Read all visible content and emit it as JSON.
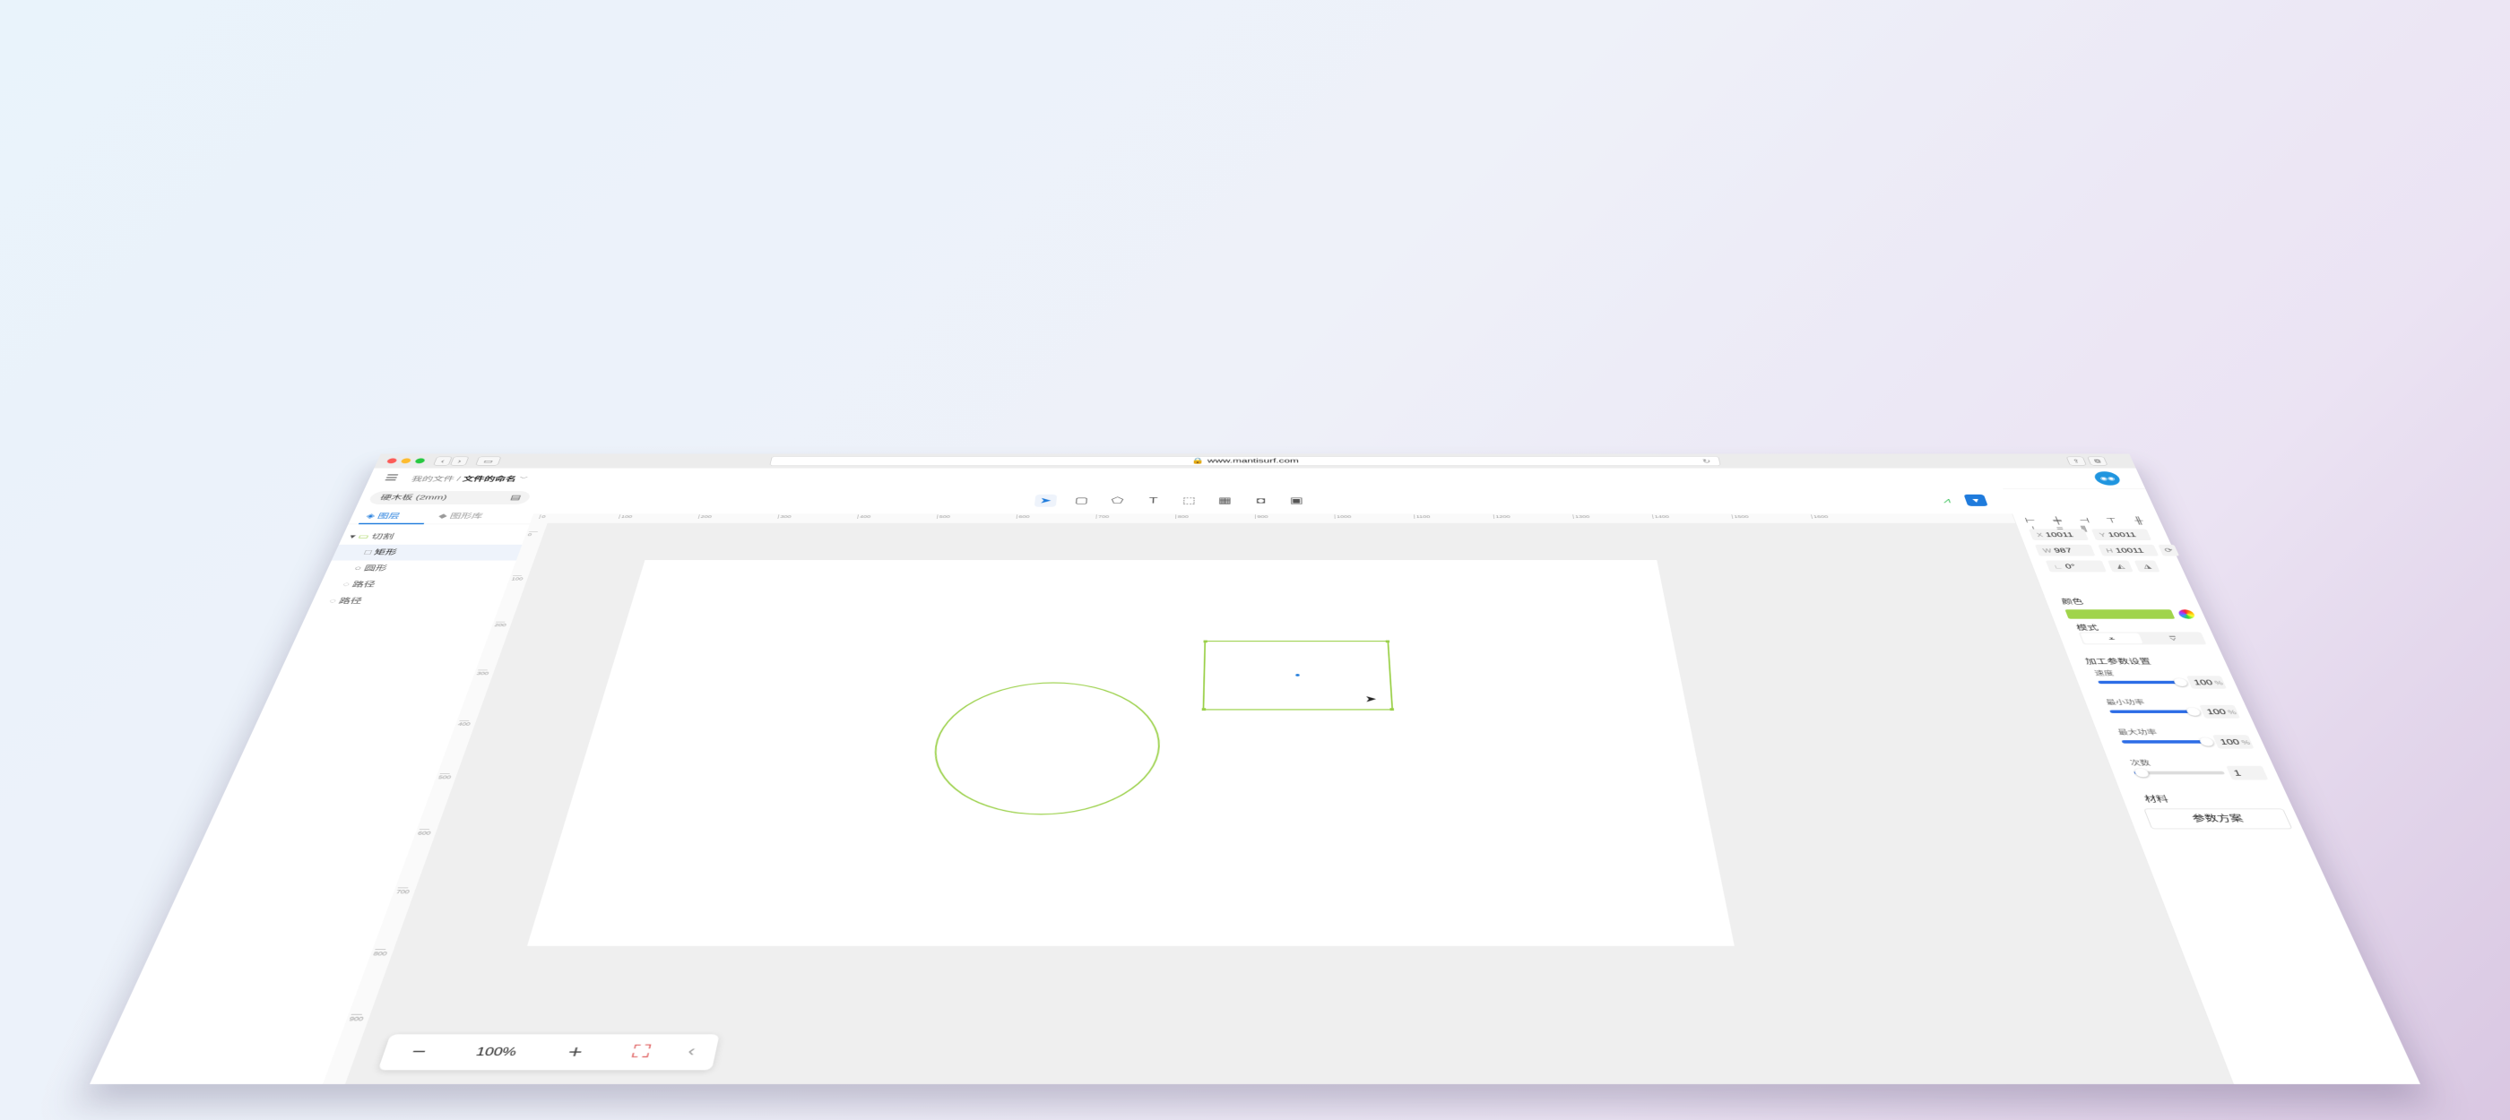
{
  "browser": {
    "url": "www.mantisurf.com",
    "lock_icon": "🔒",
    "reload_icon": "↻",
    "back_icon": "‹",
    "forward_icon": "›",
    "sidebar_icon": "▭",
    "share_icon": "⇪",
    "tabs_icon": "⧉"
  },
  "header": {
    "menu_icon": "☰",
    "breadcrumb_root": "我的文件",
    "breadcrumb_sep": "/",
    "breadcrumb_current": "文件的命名",
    "breadcrumb_chevron": "﹀",
    "avatar_text": "◉◉"
  },
  "left": {
    "material": "硬木板 (2mm)",
    "material_icon": "▤",
    "tabs": [
      {
        "label": "图层",
        "icon": "◈"
      },
      {
        "label": "图形库",
        "icon": "◆"
      }
    ],
    "layers": [
      {
        "label": "切割",
        "icon": "▭",
        "arrow": "▾"
      },
      {
        "label": "矩形",
        "icon": "□"
      },
      {
        "label": "圆形",
        "icon": "○"
      },
      {
        "label": "路径",
        "icon": "◌"
      },
      {
        "label": "路径",
        "icon": "◌"
      }
    ]
  },
  "toolbar": {
    "tools": [
      "➤",
      "▢",
      "⬠",
      "T",
      "⬚",
      "▦",
      "◘",
      "▣"
    ],
    "wifi_icon": "⩘",
    "save_icon": "▼"
  },
  "ruler": {
    "top": [
      "0",
      "100",
      "200",
      "300",
      "400",
      "500",
      "600",
      "700",
      "800",
      "900",
      "1000",
      "1100",
      "1200",
      "1300",
      "1400",
      "1500",
      "1600"
    ],
    "left": [
      "0",
      "100",
      "200",
      "300",
      "400",
      "500",
      "600",
      "700",
      "800",
      "900"
    ]
  },
  "zoom": {
    "minus": "−",
    "value": "100%",
    "plus": "+",
    "fit_icon": "⛶",
    "collapse_icon": "‹"
  },
  "properties": {
    "align_icons": "⊢ ╪ ⊣ ⊤ ╫ ⊥ ≡ ⫼",
    "x_label": "X",
    "x": "10011",
    "y_label": "Y",
    "y": "10011",
    "w_label": "W",
    "w": "987",
    "h_label": "H",
    "h": "10011",
    "lock_icon": "⟳",
    "angle_label": "∟",
    "angle": "0°",
    "flip_h_icon": "◭",
    "flip_v_icon": "◮",
    "color_label": "颜色",
    "color_value": "#a0d44b",
    "mode_label": "模式",
    "mode_on_icon": "⩡",
    "mode_off_icon": "⩢",
    "process_label": "加工参数设置",
    "speed_label": "速度",
    "speed": "100",
    "speed_unit": "%",
    "speed_fraction": 0.95,
    "minpower_label": "最小功率",
    "minpower": "100",
    "minpower_unit": "%",
    "minpower_fraction": 0.95,
    "maxpower_label": "最大功率",
    "maxpower": "100",
    "maxpower_unit": "%",
    "maxpower_fraction": 0.95,
    "passes_label": "次数",
    "passes": "1",
    "passes_fraction": 0.08,
    "material_label": "材料",
    "preset_button": "参数方案"
  }
}
